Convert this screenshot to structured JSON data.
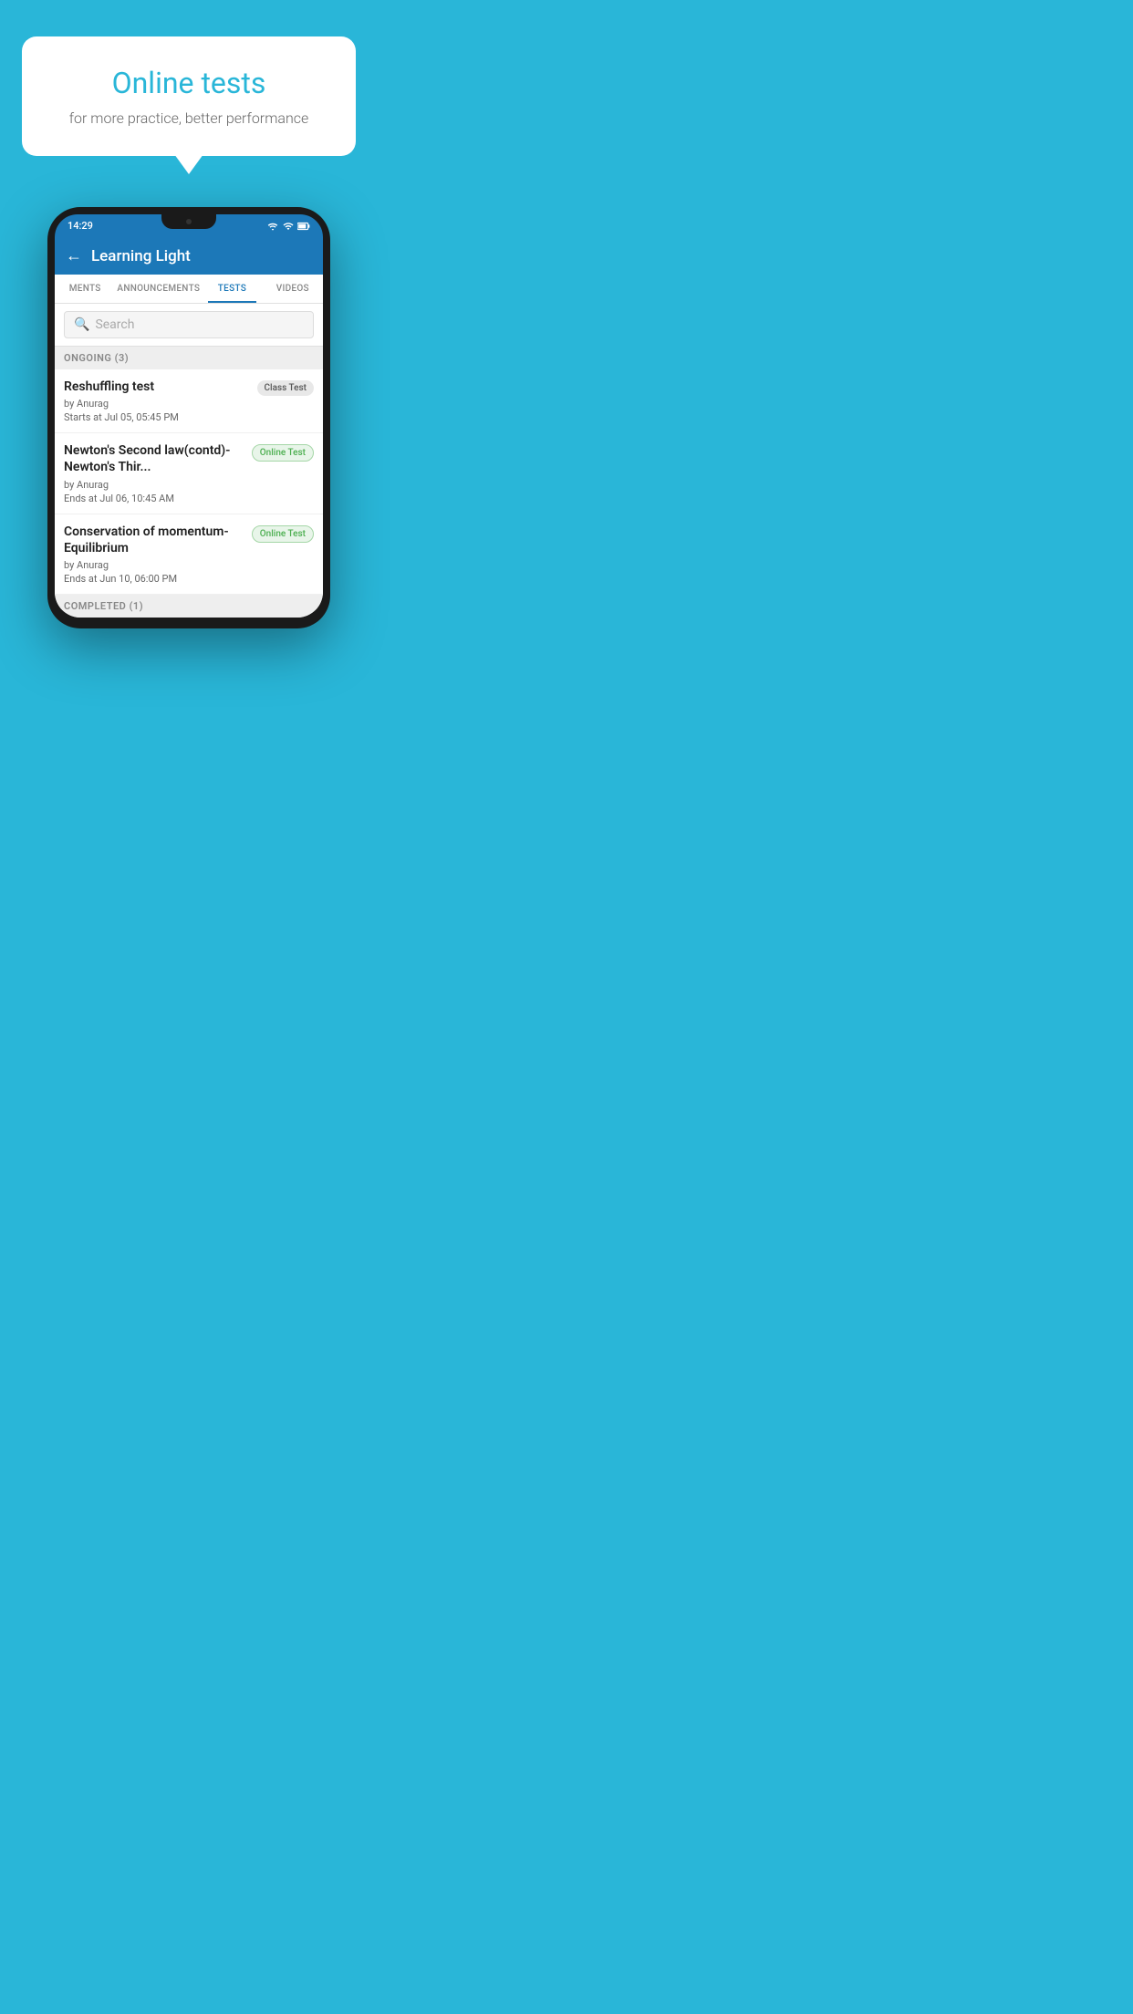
{
  "background_color": "#29b6d8",
  "promo": {
    "title": "Online tests",
    "subtitle": "for more practice, better performance"
  },
  "phone": {
    "status_time": "14:29",
    "app_title": "Learning Light",
    "back_label": "←",
    "tabs": [
      {
        "label": "MENTS",
        "active": false
      },
      {
        "label": "ANNOUNCEMENTS",
        "active": false
      },
      {
        "label": "TESTS",
        "active": true
      },
      {
        "label": "VIDEOS",
        "active": false
      }
    ],
    "search": {
      "placeholder": "Search",
      "icon": "🔍"
    },
    "ongoing_section": {
      "header": "ONGOING (3)",
      "items": [
        {
          "name": "Reshuffling test",
          "author": "by Anurag",
          "date": "Starts at  Jul 05, 05:45 PM",
          "badge": "Class Test",
          "badge_type": "class"
        },
        {
          "name": "Newton's Second law(contd)-Newton's Thir...",
          "author": "by Anurag",
          "date": "Ends at  Jul 06, 10:45 AM",
          "badge": "Online Test",
          "badge_type": "online"
        },
        {
          "name": "Conservation of momentum-Equilibrium",
          "author": "by Anurag",
          "date": "Ends at  Jun 10, 06:00 PM",
          "badge": "Online Test",
          "badge_type": "online"
        }
      ]
    },
    "completed_section": {
      "header": "COMPLETED (1)"
    }
  }
}
